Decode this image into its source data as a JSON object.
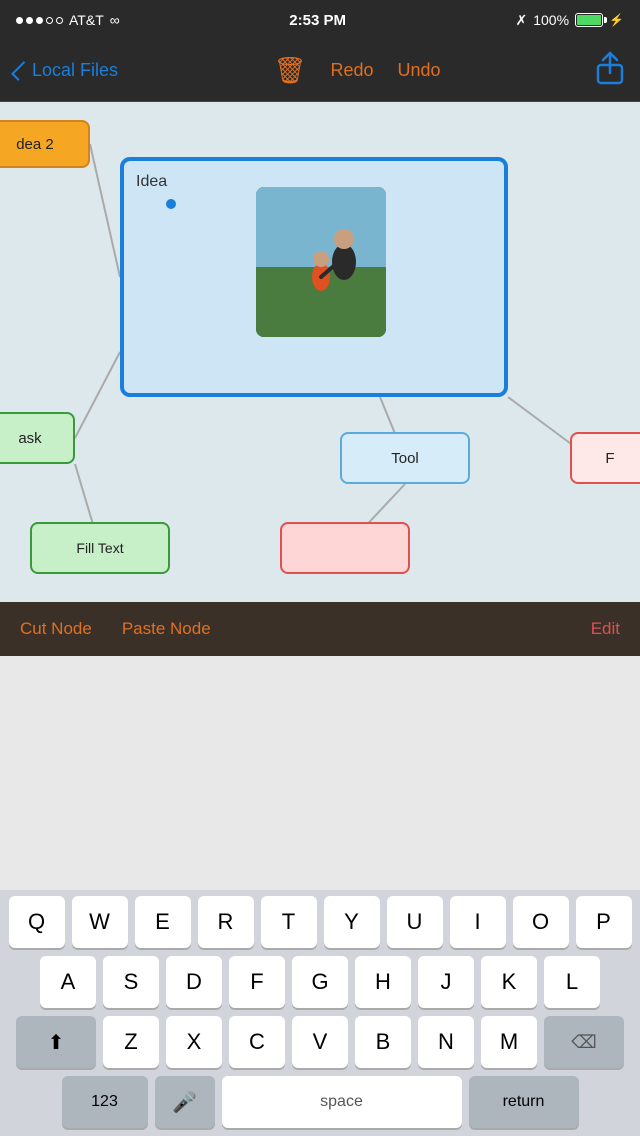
{
  "statusBar": {
    "carrier": "AT&T",
    "time": "2:53 PM",
    "battery": "100%"
  },
  "navBar": {
    "backLabel": "Local Files",
    "redoLabel": "Redo",
    "undoLabel": "Undo"
  },
  "nodes": {
    "idea2": "dea 2",
    "idea": "Idea",
    "task": "ask",
    "tool": "Tool",
    "f": "F",
    "fillText": "Fill Text"
  },
  "contextBar": {
    "cutNode": "Cut Node",
    "pasteNode": "Paste Node",
    "edit": "Edit"
  },
  "keyboard": {
    "row1": [
      "Q",
      "W",
      "E",
      "R",
      "T",
      "Y",
      "U",
      "I",
      "O",
      "P"
    ],
    "row2": [
      "A",
      "S",
      "D",
      "F",
      "G",
      "H",
      "J",
      "K",
      "L"
    ],
    "row3": [
      "Z",
      "X",
      "C",
      "V",
      "B",
      "N",
      "M"
    ],
    "numbersLabel": "123",
    "spaceLabel": "space",
    "returnLabel": "return"
  }
}
